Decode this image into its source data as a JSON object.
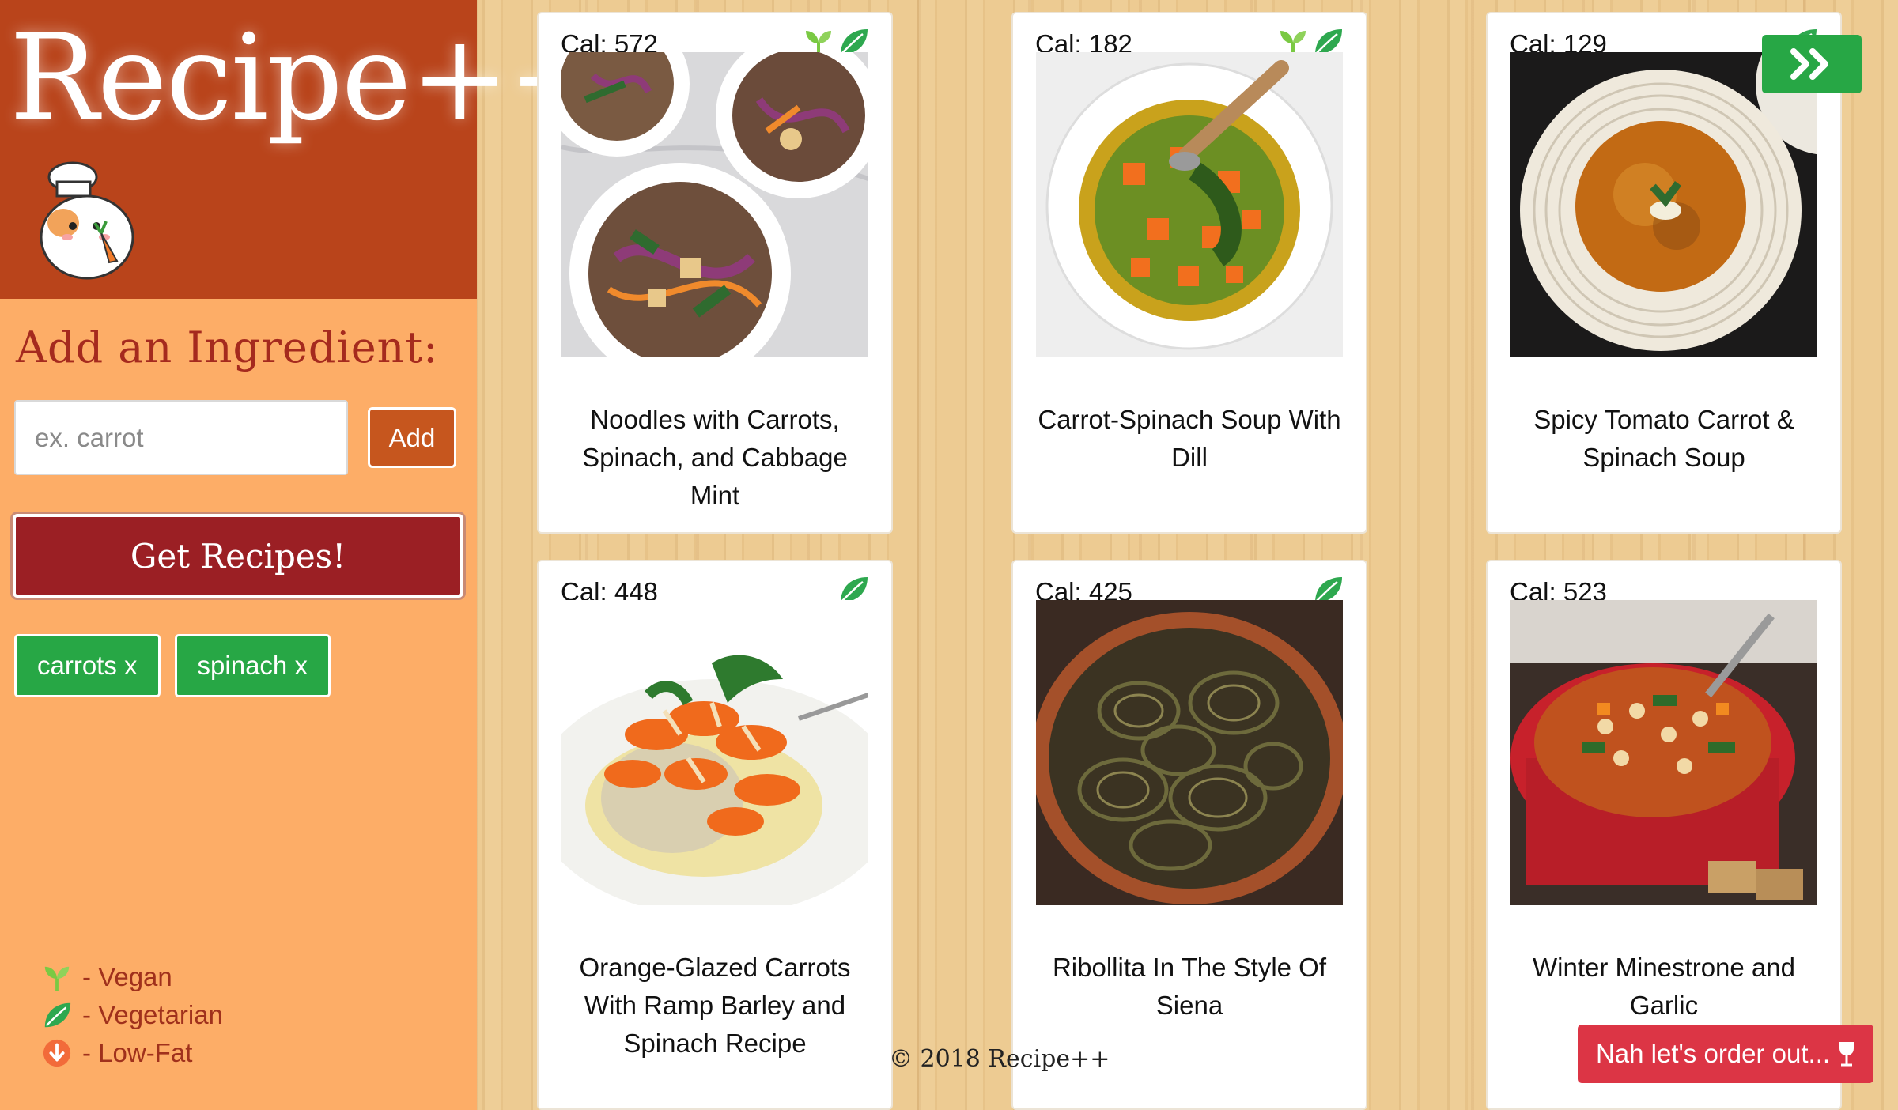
{
  "app": {
    "title": "Recipe++"
  },
  "sidebar": {
    "heading": "Add an Ingredient:",
    "input_placeholder": "ex. carrot",
    "input_value": "",
    "add_label": "Add",
    "get_recipes_label": "Get Recipes!",
    "chips": [
      "carrots x",
      "spinach x"
    ],
    "legend": [
      {
        "icon": "vegan-sprout-icon",
        "label": "- Vegan"
      },
      {
        "icon": "vegetarian-leaf-icon",
        "label": "- Vegetarian"
      },
      {
        "icon": "low-fat-arrow-icon",
        "label": "- Low-Fat"
      }
    ]
  },
  "colors": {
    "brand_dark": "#b9441b",
    "sidebar": "#fdad67",
    "heading": "#a52a1e",
    "get_recipes": "#9b1f24",
    "chip_green": "#27a745",
    "danger": "#dc3545",
    "vegan_green": "#7ac943",
    "vegetarian_green": "#2ea84f",
    "low_fat_orange": "#f26b3a"
  },
  "recipes": [
    {
      "calories": "Cal: 572",
      "title": "Noodles with Carrots, Spinach, and Cabbage Mint",
      "badges": [
        "vegan-sprout-icon",
        "vegetarian-leaf-icon"
      ],
      "photo": "noodle-bowls-photo"
    },
    {
      "calories": "Cal: 182",
      "title": "Carrot-Spinach Soup With Dill",
      "badges": [
        "vegan-sprout-icon",
        "vegetarian-leaf-icon"
      ],
      "photo": "carrot-spinach-soup-photo"
    },
    {
      "calories": "Cal: 129",
      "title": "Spicy Tomato Carrot & Spinach Soup",
      "badges": [
        "vegetarian-leaf-icon"
      ],
      "photo": "tomato-soup-plate-photo"
    },
    {
      "calories": "Cal: 448",
      "title": "Orange-Glazed Carrots With Ramp Barley and Spinach Recipe",
      "badges": [
        "vegetarian-leaf-icon"
      ],
      "photo": "glazed-carrots-photo"
    },
    {
      "calories": "Cal: 425",
      "title": "Ribollita In The Style Of Siena",
      "badges": [
        "vegetarian-leaf-icon"
      ],
      "photo": "ribollita-pot-photo"
    },
    {
      "calories": "Cal: 523",
      "title": "Winter Minestrone and Garlic",
      "badges": [],
      "photo": "minestrone-pot-photo"
    }
  ],
  "navigation": {
    "next_icon": "double-chevron-right-icon"
  },
  "footer": {
    "copyright": "© 2018 Recipe++"
  },
  "order_out": {
    "label": "Nah let's order out...",
    "icon": "wine-glass-icon"
  }
}
